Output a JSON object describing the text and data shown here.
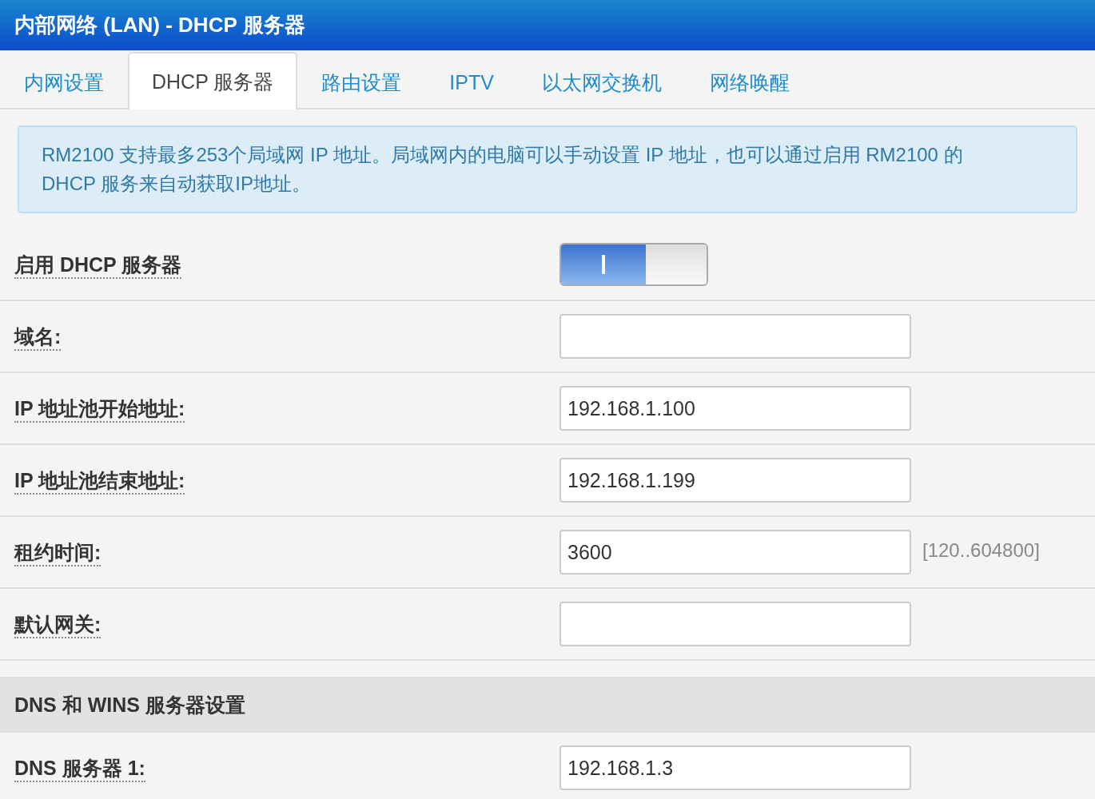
{
  "window": {
    "title": "内部网络 (LAN) - DHCP 服务器"
  },
  "tabs": [
    {
      "label": "内网设置",
      "selected": false
    },
    {
      "label": "DHCP 服务器",
      "selected": true
    },
    {
      "label": "路由设置",
      "selected": false
    },
    {
      "label": "IPTV",
      "selected": false
    },
    {
      "label": "以太网交换机",
      "selected": false
    },
    {
      "label": "网络唤醒",
      "selected": false
    }
  ],
  "info": "RM2100 支持最多253个局域网 IP 地址。局域网内的电脑可以手动设置 IP 地址，也可以通过启用 RM2100 的 DHCP 服务来自动获取IP地址。",
  "rows": [
    {
      "kind": "toggle",
      "label": "启用 DHCP 服务器",
      "on": true
    },
    {
      "kind": "field",
      "label": "域名:"
    },
    {
      "kind": "field",
      "label": "IP 地址池开始地址:",
      "value": "192.168.1.100"
    },
    {
      "kind": "field",
      "label": "IP 地址池结束地址:",
      "value": "192.168.1.199"
    },
    {
      "kind": "field",
      "label": "租约时间:",
      "value": "3600",
      "hint": "[120..604800]"
    },
    {
      "kind": "field",
      "label": "默认网关:"
    },
    {
      "kind": "section",
      "label": "DNS 和 WINS 服务器设置"
    },
    {
      "kind": "field",
      "label": "DNS 服务器 1:",
      "value": "192.168.1.3"
    }
  ]
}
